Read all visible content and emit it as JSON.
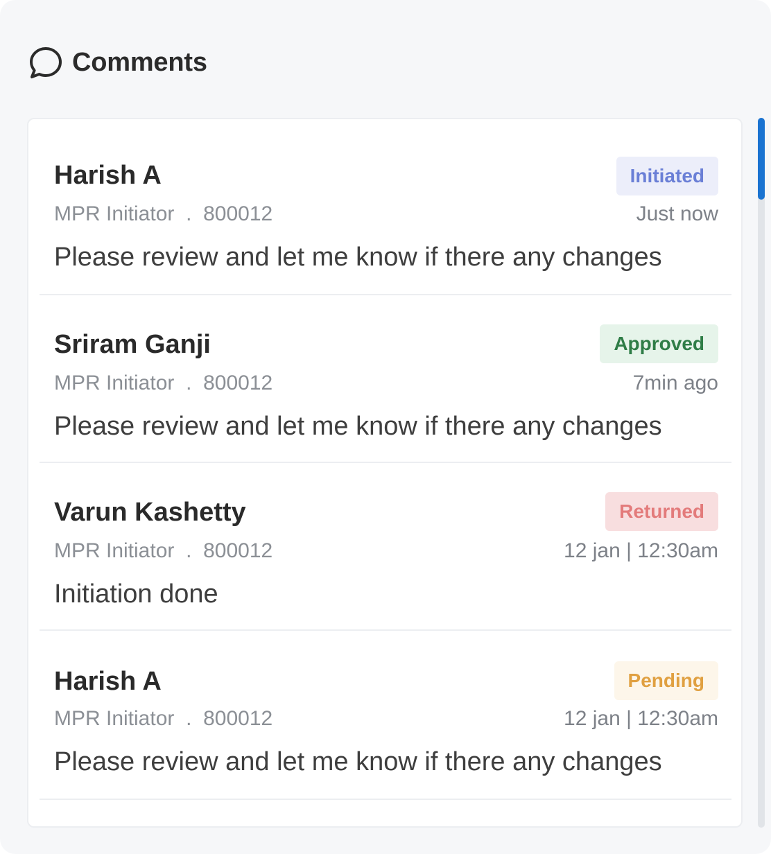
{
  "header": {
    "title": "Comments",
    "icon": "chat-bubble-icon"
  },
  "comments": [
    {
      "name": "Harish A",
      "role": "MPR Initiator",
      "separator": ".",
      "id": "800012",
      "status": "Initiated",
      "status_color": "#6a7fd6",
      "status_bg": "#eceefa",
      "time": "Just now",
      "message": "Please review and let me know if there any changes"
    },
    {
      "name": "Sriram Ganji",
      "role": "MPR Initiator",
      "separator": ".",
      "id": "800012",
      "status": "Approved",
      "status_color": "#2f7d47",
      "status_bg": "#e6f4ea",
      "time": "7min ago",
      "message": "Please review and let me know if there any changes"
    },
    {
      "name": "Varun Kashetty",
      "role": "MPR Initiator",
      "separator": ".",
      "id": "800012",
      "status": "Returned",
      "status_color": "#e37b7b",
      "status_bg": "#f8dedf",
      "time": "12 jan | 12:30am",
      "message": "Initiation done"
    },
    {
      "name": "Harish A",
      "role": "MPR Initiator",
      "separator": ".",
      "id": "800012",
      "status": "Pending",
      "status_color": "#e0a041",
      "status_bg": "#fdf6ea",
      "time": "12 jan | 12:30am",
      "message": "Please review and let me know if there any changes"
    }
  ],
  "scrollbar": {
    "thumb_color": "#1a73d1"
  }
}
